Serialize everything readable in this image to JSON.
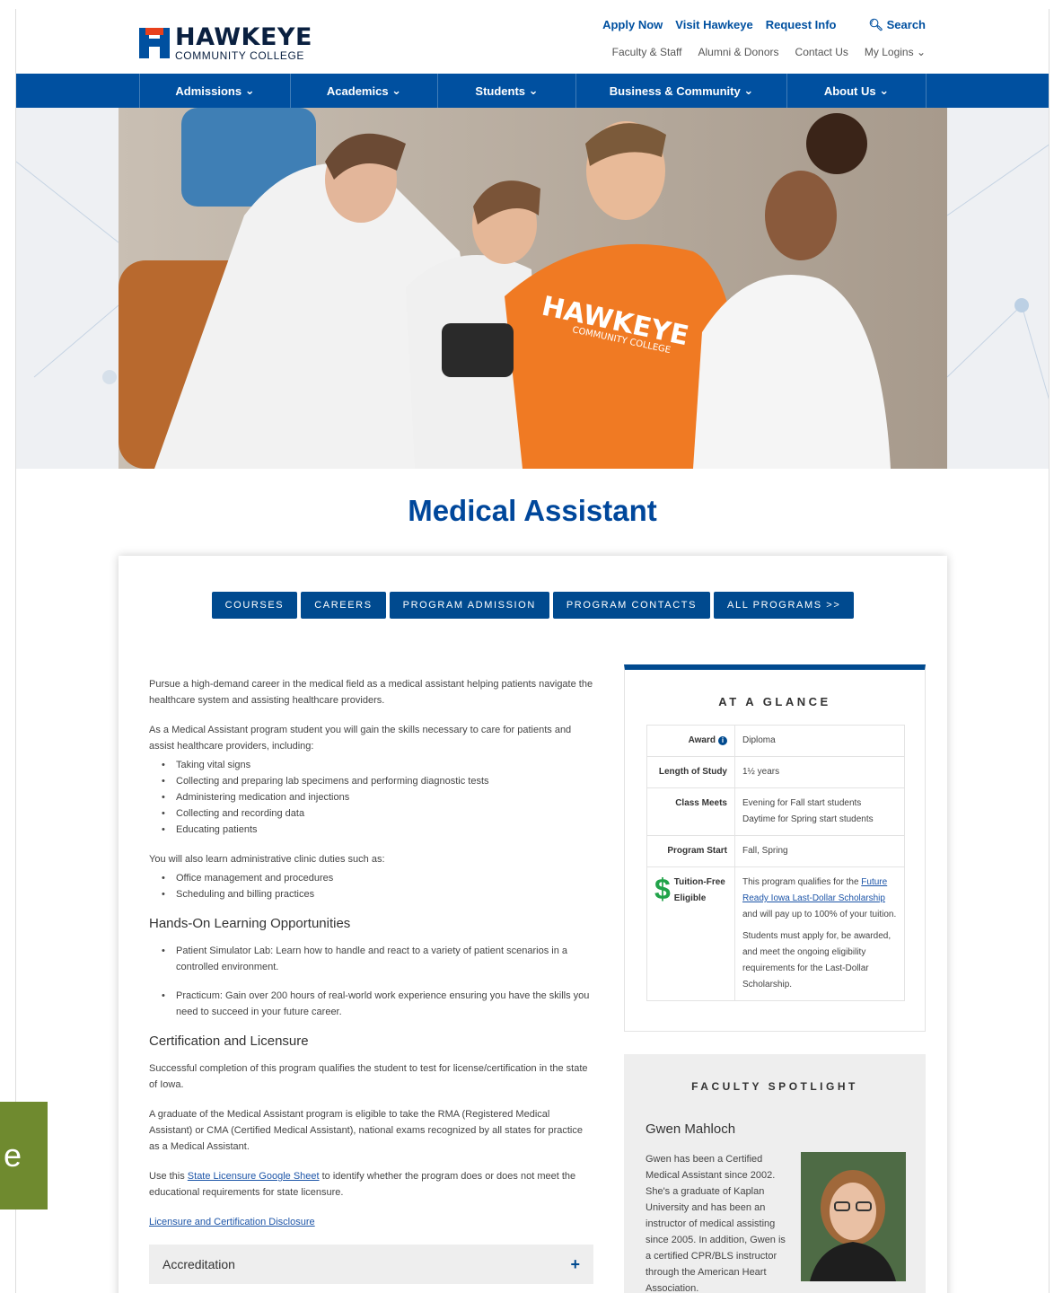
{
  "logo": {
    "name": "HAWKEYE",
    "sub": "COMMUNITY COLLEGE"
  },
  "utility": {
    "top": [
      "Apply Now",
      "Visit Hawkeye",
      "Request Info"
    ],
    "search": "Search",
    "bottom": [
      "Faculty & Staff",
      "Alumni & Donors",
      "Contact Us",
      "My Logins"
    ]
  },
  "nav": [
    "Admissions",
    "Academics",
    "Students",
    "Business & Community",
    "About Us"
  ],
  "hero": {
    "shirt_text": "HAWKEYE",
    "shirt_sub": "COMMUNITY COLLEGE"
  },
  "page_title": "Medical Assistant",
  "tabs": [
    "COURSES",
    "CAREERS",
    "PROGRAM ADMISSION",
    "PROGRAM CONTACTS",
    "ALL PROGRAMS >>"
  ],
  "content": {
    "intro": "Pursue a high-demand career in the medical field as a medical assistant helping patients navigate the healthcare system and assisting healthcare providers.",
    "skills_intro": "As a Medical Assistant program student you will gain the skills necessary to care for patients and assist healthcare providers, including:",
    "skills": [
      "Taking vital signs",
      "Collecting and preparing lab specimens and performing diagnostic tests",
      "Administering medication and injections",
      "Collecting and recording data",
      "Educating patients"
    ],
    "admin_intro": "You will also learn administrative clinic duties such as:",
    "admin": [
      "Office management and procedures",
      "Scheduling and billing practices"
    ],
    "handson_heading": "Hands-On Learning Opportunities",
    "handson": [
      "Patient Simulator Lab: Learn how to handle and react to a variety of patient scenarios in a controlled environment.",
      "Practicum: Gain over 200 hours of real-world work experience ensuring you have the skills you need to succeed in your future career."
    ],
    "cert_heading": "Certification and Licensure",
    "cert_p1": "Successful completion of this program qualifies the student to test for license/certification in the state of Iowa.",
    "cert_p2": "A graduate of the Medical Assistant program is eligible to take the RMA (Registered Medical Assistant) or CMA (Certified Medical Assistant), national exams recognized by all states for practice as a Medical Assistant.",
    "cert_p3_pre": "Use this ",
    "cert_p3_link": "State Licensure Google Sheet",
    "cert_p3_post": " to identify whether the program does or does not meet the educational requirements for state licensure.",
    "disclosure_link": "Licensure and Certification Disclosure",
    "accordion": "Accreditation"
  },
  "glance": {
    "title": "AT A GLANCE",
    "award_label": "Award",
    "award_value": "Diploma",
    "length_label": "Length of Study",
    "length_value": "1½ years",
    "meets_label": "Class Meets",
    "meets_value1": "Evening for Fall start students",
    "meets_value2": "Daytime for Spring start students",
    "start_label": "Program Start",
    "start_value": "Fall, Spring",
    "tuition_label": "Tuition-Free Eligible",
    "tuition_pre": "This program qualifies for the ",
    "tuition_link": "Future Ready Iowa Last-Dollar Scholarship",
    "tuition_post": " and will pay up to 100% of your tuition.",
    "tuition_note": "Students must apply for, be awarded, and meet the ongoing eligibility requirements for the Last-Dollar Scholarship."
  },
  "spotlight": {
    "title": "FACULTY SPOTLIGHT",
    "name": "Gwen Mahloch",
    "bio": "Gwen has been a Certified Medical Assistant since 2002. She's a graduate of Kaplan University and has been an instructor of medical assisting since 2005. In addition, Gwen is a certified CPR/BLS instructor through the American Heart Association."
  },
  "side_tab": "e",
  "colors": {
    "brand_blue": "#0050a0",
    "dark_blue": "#004a8f",
    "accent_orange": "#e8401c",
    "green": "#22a34a",
    "side_tab": "#6f8a2f"
  }
}
